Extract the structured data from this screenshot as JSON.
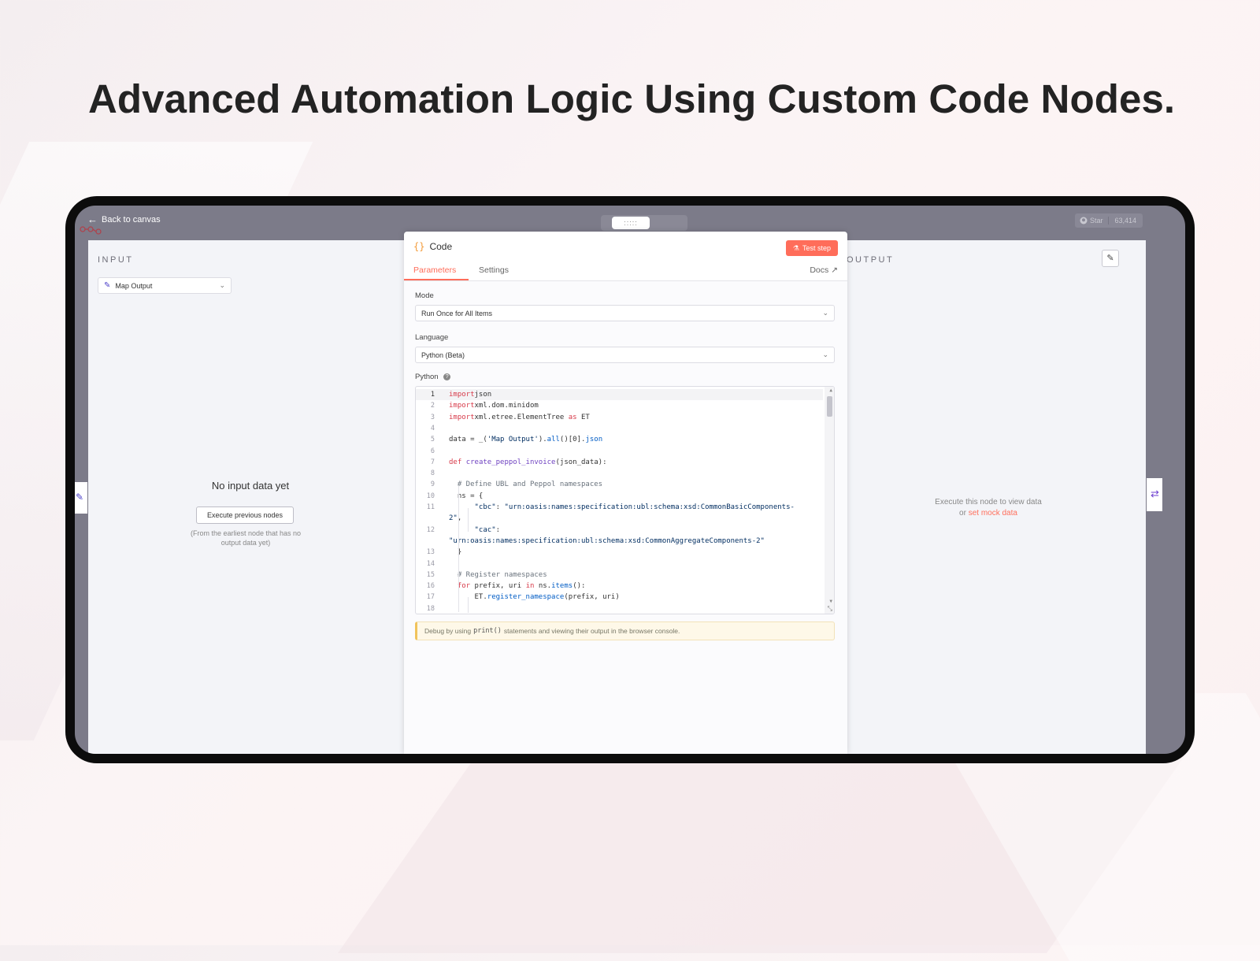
{
  "headline": "Advanced Automation Logic Using Custom Code Nodes.",
  "topbar": {
    "back_label": "Back to canvas",
    "drag_handle_glyph": ":::::",
    "github_star_label": "Star",
    "github_star_count": "63,414"
  },
  "input_panel": {
    "label": "INPUT",
    "node_select_value": "Map Output",
    "empty_title": "No input data yet",
    "execute_button": "Execute previous nodes",
    "empty_note": "(From the earliest node that has no output data yet)"
  },
  "output_panel": {
    "label": "OUTPUT",
    "message_line1": "Execute this node to view data",
    "message_prefix": "or",
    "mock_link": "set mock data"
  },
  "code_panel": {
    "title": "Code",
    "test_button": "Test step",
    "tabs": [
      {
        "label": "Parameters",
        "active": true
      },
      {
        "label": "Settings",
        "active": false
      }
    ],
    "docs_label": "Docs",
    "mode_label": "Mode",
    "mode_value": "Run Once for All Items",
    "language_label": "Language",
    "language_value": "Python (Beta)",
    "python_label": "Python",
    "debug_prefix": "Debug by using",
    "debug_code": "print()",
    "debug_suffix": "statements and viewing their output in the browser console."
  },
  "code_lines": [
    {
      "n": "1",
      "segs": [
        [
          "kw",
          "import"
        ],
        [
          "",
          "json"
        ]
      ]
    },
    {
      "n": "2",
      "segs": [
        [
          "kw",
          "import"
        ],
        [
          "",
          "xml.dom.minidom"
        ]
      ]
    },
    {
      "n": "3",
      "segs": [
        [
          "kw",
          "import"
        ],
        [
          "",
          "xml.etree.ElementTree "
        ],
        [
          "kw",
          "as"
        ],
        [
          "",
          " ET"
        ]
      ]
    },
    {
      "n": "4",
      "segs": []
    },
    {
      "n": "5",
      "segs": [
        [
          "",
          "data = _("
        ],
        [
          "str",
          "'Map Output'"
        ],
        [
          "",
          ")."
        ],
        [
          "attr",
          "all"
        ],
        [
          "",
          "()[0]."
        ],
        [
          "attr",
          "json"
        ]
      ]
    },
    {
      "n": "6",
      "segs": []
    },
    {
      "n": "7",
      "segs": [
        [
          "kw",
          "def"
        ],
        [
          "",
          " "
        ],
        [
          "fn",
          "create_peppol_invoice"
        ],
        [
          "",
          "(json_data):"
        ]
      ]
    },
    {
      "n": "8",
      "segs": []
    },
    {
      "n": "9",
      "segs": [
        [
          "",
          "  "
        ],
        [
          "cm",
          "# Define UBL and Peppol namespaces"
        ]
      ]
    },
    {
      "n": "10",
      "segs": [
        [
          "",
          "  ns = {"
        ]
      ]
    },
    {
      "n": "11",
      "segs": [
        [
          "",
          "      "
        ],
        [
          "str",
          "\"cbc\""
        ],
        [
          "",
          ": "
        ],
        [
          "str",
          "\"urn:oasis:names:specification:ubl:schema:xsd:CommonBasicComponents-"
        ]
      ]
    },
    {
      "n": "",
      "segs": [
        [
          "str",
          "2\""
        ],
        [
          "",
          ","
        ]
      ]
    },
    {
      "n": "12",
      "segs": [
        [
          "",
          "      "
        ],
        [
          "str",
          "\"cac\""
        ],
        [
          "",
          ":"
        ]
      ]
    },
    {
      "n": "",
      "segs": [
        [
          "str",
          "\"urn:oasis:names:specification:ubl:schema:xsd:CommonAggregateComponents-2\""
        ]
      ]
    },
    {
      "n": "13",
      "segs": [
        [
          "",
          "  }"
        ]
      ]
    },
    {
      "n": "14",
      "segs": []
    },
    {
      "n": "15",
      "segs": [
        [
          "",
          "  "
        ],
        [
          "cm",
          "# Register namespaces"
        ]
      ]
    },
    {
      "n": "16",
      "segs": [
        [
          "",
          "  "
        ],
        [
          "kw",
          "for"
        ],
        [
          "",
          " prefix, uri "
        ],
        [
          "kw",
          "in"
        ],
        [
          "",
          " ns."
        ],
        [
          "attr",
          "items"
        ],
        [
          "",
          "():"
        ]
      ]
    },
    {
      "n": "17",
      "segs": [
        [
          "",
          "      ET."
        ],
        [
          "attr",
          "register_namespace"
        ],
        [
          "",
          "(prefix, uri)"
        ]
      ]
    },
    {
      "n": "18",
      "segs": []
    }
  ]
}
